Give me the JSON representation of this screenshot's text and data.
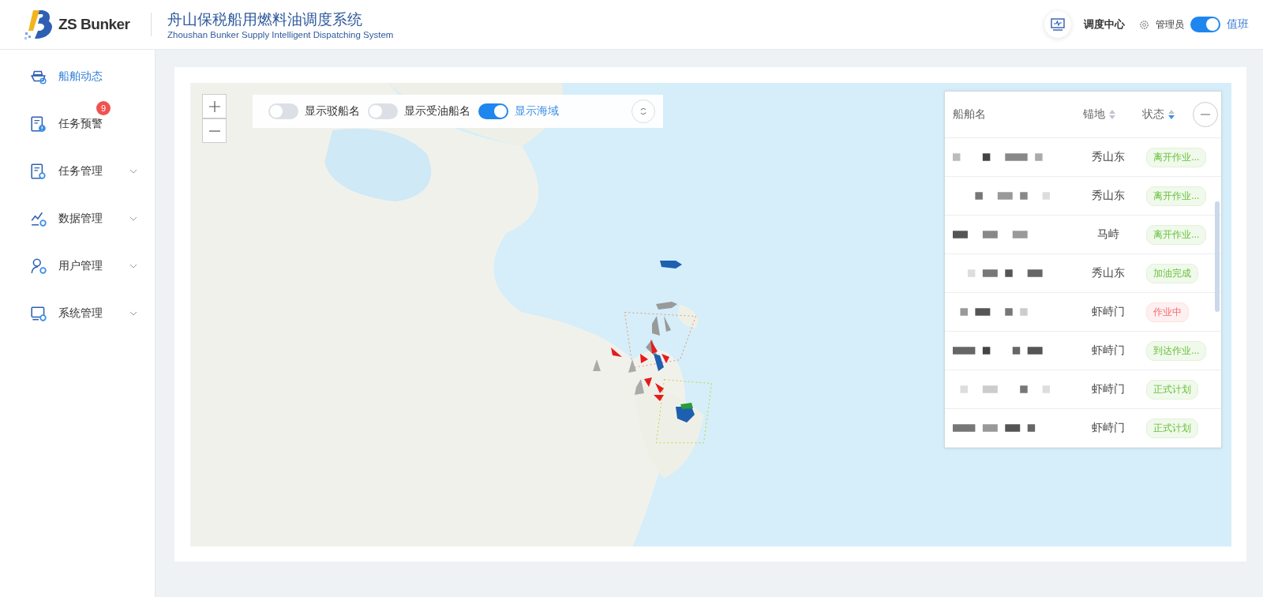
{
  "header": {
    "logo_text": "ZS Bunker",
    "title": "舟山保税船用燃料油调度系统",
    "subtitle": "Zhoushan Bunker Supply Intelligent Dispatching System",
    "dispatch_center": "调度中心",
    "role": "管理员",
    "duty_toggle": {
      "on": true,
      "label": "值班"
    }
  },
  "sidebar": {
    "items": [
      {
        "label": "船舶动态",
        "selected": true,
        "submenu": false
      },
      {
        "label": "任务预警",
        "selected": false,
        "submenu": false,
        "badge": "9"
      },
      {
        "label": "任务管理",
        "selected": false,
        "submenu": true
      },
      {
        "label": "数据管理",
        "selected": false,
        "submenu": true
      },
      {
        "label": "用户管理",
        "selected": false,
        "submenu": true
      },
      {
        "label": "系统管理",
        "selected": false,
        "submenu": true
      }
    ]
  },
  "map_toolbar": {
    "toggles": [
      {
        "label": "显示驳船名",
        "on": false
      },
      {
        "label": "显示受油船名",
        "on": false
      },
      {
        "label": "显示海域",
        "on": true
      }
    ]
  },
  "ship_table": {
    "columns": [
      {
        "label": "船舶名",
        "sortable": false
      },
      {
        "label": "锚地",
        "sortable": true,
        "sorted_desc": false
      },
      {
        "label": "状态",
        "sortable": true,
        "sorted_desc": true
      }
    ],
    "rows": [
      {
        "anchorage": "秀山东",
        "status": "离开作业...",
        "kind": "success"
      },
      {
        "anchorage": "秀山东",
        "status": "离开作业...",
        "kind": "success"
      },
      {
        "anchorage": "马峙",
        "status": "离开作业...",
        "kind": "success"
      },
      {
        "anchorage": "秀山东",
        "status": "加油完成",
        "kind": "success"
      },
      {
        "anchorage": "虾峙门",
        "status": "作业中",
        "kind": "danger"
      },
      {
        "anchorage": "虾峙门",
        "status": "到达作业...",
        "kind": "success"
      },
      {
        "anchorage": "虾峙门",
        "status": "正式计划",
        "kind": "success"
      },
      {
        "anchorage": "虾峙门",
        "status": "正式计划",
        "kind": "success"
      }
    ]
  }
}
